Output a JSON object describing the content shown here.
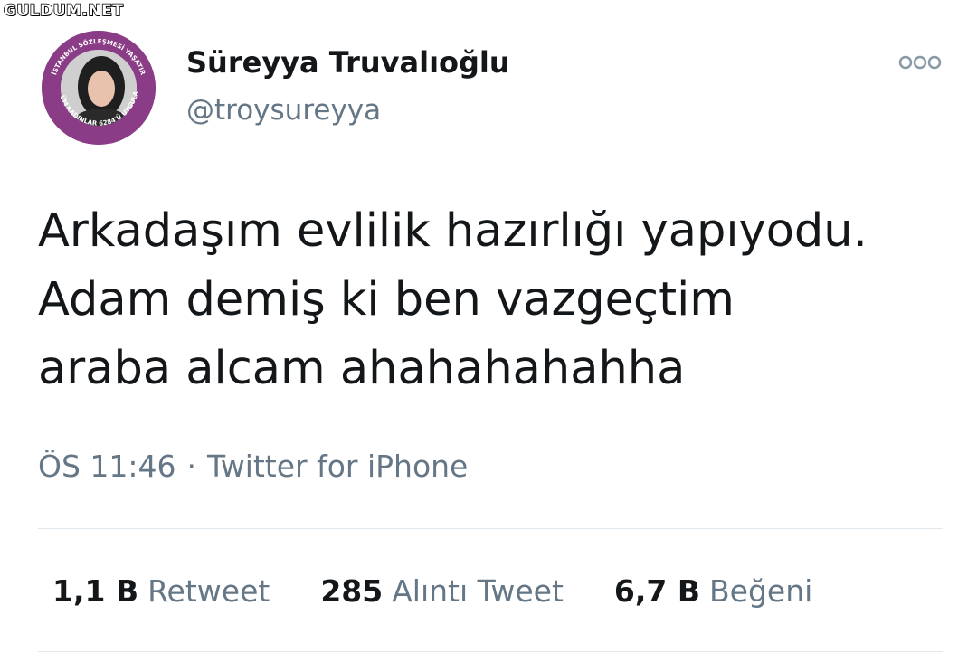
{
  "watermark": "GULDUM.NET",
  "user": {
    "display_name": "Süreyya Truvalıoğlu",
    "handle": "@troysureyya",
    "avatar_badge_text_top": "İSTANBUL SÖZLEŞMESİ YAŞATIR",
    "avatar_badge_text_bottom": "TÜM KADINLAR 6284'Ü UYGULA",
    "avatar_ring_color": "#8a3d86"
  },
  "tweet": {
    "text": "Arkadaşım evlilik hazırlığı yapıyodu.\nAdam demiş ki ben vazgeçtim\naraba alcam ahahahahahha",
    "time": "ÖS 11:46",
    "separator": "·",
    "source": "Twitter for iPhone"
  },
  "stats": [
    {
      "count": "1,1 B",
      "label": "Retweet"
    },
    {
      "count": "285",
      "label": "Alıntı Tweet"
    },
    {
      "count": "6,7 B",
      "label": "Beğeni"
    }
  ],
  "icons": {
    "more": "more-options-icon"
  },
  "colors": {
    "text_primary": "#14171a",
    "text_secondary": "#657786",
    "divider": "#e1e8ed"
  }
}
